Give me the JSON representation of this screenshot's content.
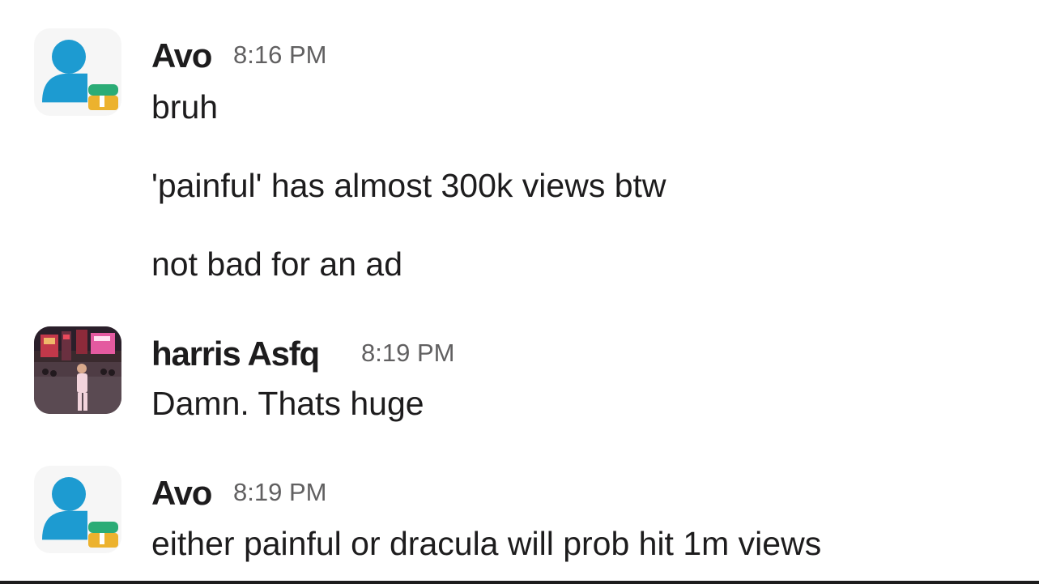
{
  "messages": [
    {
      "author": "Avo",
      "time": "8:16 PM",
      "avatar_icon": "default-user-icon",
      "lines": [
        "bruh",
        "'painful' has almost 300k views btw",
        "not bad for an ad"
      ]
    },
    {
      "author": "harris Asfq",
      "time": "8:19 PM",
      "avatar_icon": "photo-avatar",
      "lines": [
        "Damn. Thats huge"
      ]
    },
    {
      "author": "Avo",
      "time": "8:19 PM",
      "avatar_icon": "default-user-icon",
      "lines": [
        "either painful or dracula will prob hit 1m views"
      ]
    }
  ],
  "colors": {
    "text": "#1d1c1d",
    "timestamp": "#616061",
    "avatar_blue": "#1d9bd1",
    "avatar_green": "#2bac76",
    "avatar_yellow": "#ecb22e"
  }
}
